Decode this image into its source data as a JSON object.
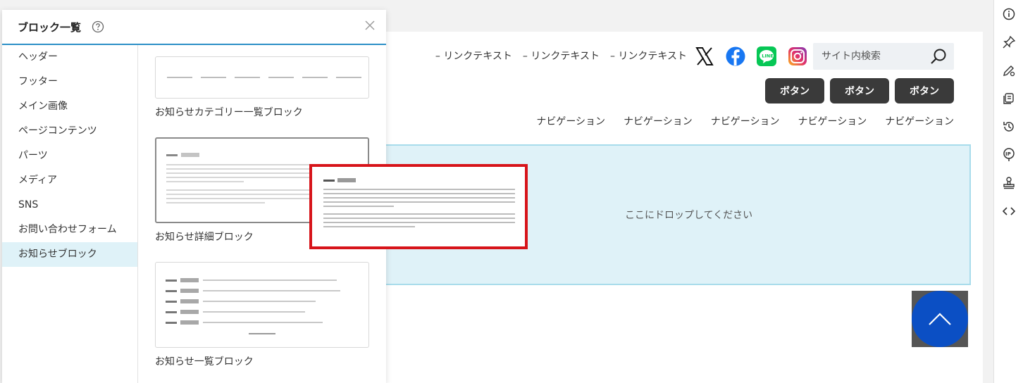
{
  "panel": {
    "title": "ブロック一覧",
    "categories": [
      {
        "label": "ヘッダー"
      },
      {
        "label": "フッター"
      },
      {
        "label": "メイン画像"
      },
      {
        "label": "ページコンテンツ"
      },
      {
        "label": "パーツ"
      },
      {
        "label": "メディア"
      },
      {
        "label": "SNS"
      },
      {
        "label": "お問い合わせフォーム"
      },
      {
        "label": "お知らせブロック",
        "active": true
      }
    ],
    "blocks": [
      {
        "label": "お知らせカテゴリー一覧ブロック"
      },
      {
        "label": "お知らせ詳細ブロック"
      },
      {
        "label": "お知らせ一覧ブロック"
      }
    ]
  },
  "canvas": {
    "header_links": [
      "リンクテキスト",
      "リンクテキスト",
      "リンクテキスト"
    ],
    "sns_icons": [
      "x-icon",
      "facebook-icon",
      "line-icon",
      "instagram-icon"
    ],
    "search_placeholder": "サイト内検索",
    "buttons": [
      "ボタン",
      "ボタン",
      "ボタン"
    ],
    "nav": [
      "ナビゲーション",
      "ナビゲーション",
      "ナビゲーション",
      "ナビゲーション",
      "ナビゲーション"
    ],
    "drop_text": "ここにドロップしてください"
  },
  "right_toolbar": {
    "icons": [
      "info-icon",
      "pin-icon",
      "edit-settings-icon",
      "pages-icon",
      "history-icon",
      "ip-icon",
      "stamp-icon",
      "code-icon"
    ]
  },
  "colors": {
    "accent": "#2b8fc6",
    "active_bg": "#dff2f8",
    "drop_border": "#a8dceb",
    "button_dark": "#3a3a3a",
    "back_top": "#0b4fc4",
    "drag_outline": "#d7141a"
  }
}
